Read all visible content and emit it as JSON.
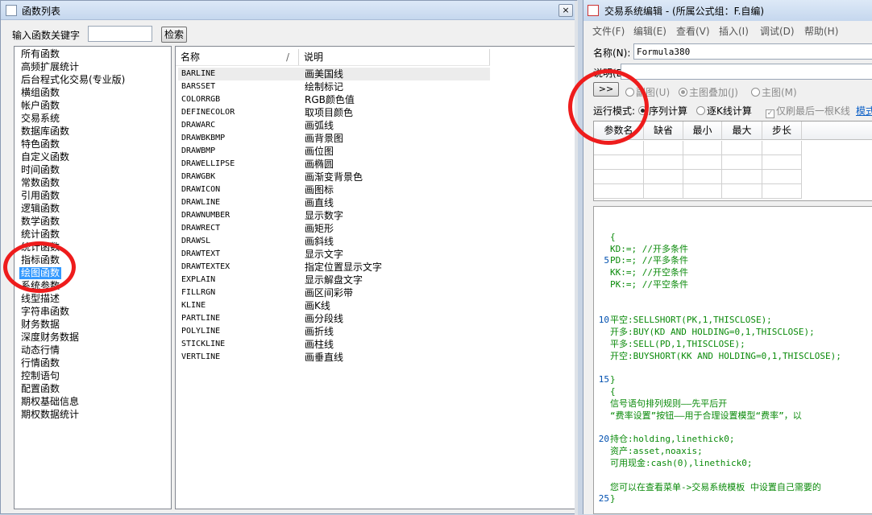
{
  "function_dialog": {
    "title": "函数列表",
    "close_label": "×",
    "keyword_label": "输入函数关键字",
    "keyword_value": "",
    "search_label": "检索",
    "categories": [
      "所有函数",
      "高频扩展统计",
      "后台程式化交易(专业版)",
      "横组函数",
      "帐户函数",
      "交易系统",
      "数据库函数",
      "特色函数",
      "自定义函数",
      "时间函数",
      "常数函数",
      "引用函数",
      "逻辑函数",
      "数学函数",
      "统计函数",
      "统计函数",
      "指标函数",
      "绘图函数",
      "系统参数",
      "线型描述",
      "字符串函数",
      "财务数据",
      "深度财务数据",
      "动态行情",
      "行情函数",
      "控制语句",
      "配置函数",
      "期权基础信息",
      "期权数据统计"
    ],
    "selected_category": "绘图函数",
    "columns": {
      "name": "名称",
      "sort_mark": "/",
      "desc": "说明"
    },
    "functions": [
      {
        "name": "BARLINE",
        "desc": "画美国线"
      },
      {
        "name": "BARSSET",
        "desc": "绘制标记"
      },
      {
        "name": "COLORRGB",
        "desc": "RGB颜色值"
      },
      {
        "name": "DEFINECOLOR",
        "desc": "取项目颜色"
      },
      {
        "name": "DRAWARC",
        "desc": "画弧线"
      },
      {
        "name": "DRAWBKBMP",
        "desc": "画背景图"
      },
      {
        "name": "DRAWBMP",
        "desc": "画位图"
      },
      {
        "name": "DRAWELLIPSE",
        "desc": "画椭圆"
      },
      {
        "name": "DRAWGBK",
        "desc": "画渐变背景色"
      },
      {
        "name": "DRAWICON",
        "desc": "画图标"
      },
      {
        "name": "DRAWLINE",
        "desc": "画直线"
      },
      {
        "name": "DRAWNUMBER",
        "desc": "显示数字"
      },
      {
        "name": "DRAWRECT",
        "desc": "画矩形"
      },
      {
        "name": "DRAWSL",
        "desc": "画斜线"
      },
      {
        "name": "DRAWTEXT",
        "desc": "显示文字"
      },
      {
        "name": "DRAWTEXTEX",
        "desc": "指定位置显示文字"
      },
      {
        "name": "EXPLAIN",
        "desc": "显示解盘文字"
      },
      {
        "name": "FILLRGN",
        "desc": "画区间彩带"
      },
      {
        "name": "KLINE",
        "desc": "画K线"
      },
      {
        "name": "PARTLINE",
        "desc": "画分段线"
      },
      {
        "name": "POLYLINE",
        "desc": "画折线"
      },
      {
        "name": "STICKLINE",
        "desc": "画柱线"
      },
      {
        "name": "VERTLINE",
        "desc": "画垂直线"
      }
    ]
  },
  "editor_window": {
    "title": "交易系统编辑 - (所属公式组：F.自编)",
    "menu": [
      "文件(F)",
      "编辑(E)",
      "查看(V)",
      "插入(I)",
      "调试(D)",
      "帮助(H)"
    ],
    "name_label": "名称(N):",
    "name_value": "Formula380",
    "desc_label": "说明(D):",
    "desc_value": "",
    "expand_label": ">>",
    "chart_options": [
      {
        "label": "副图(U)",
        "checked": false,
        "enabled": false
      },
      {
        "label": "主图叠加(J)",
        "checked": true,
        "enabled": false
      },
      {
        "label": "主图(M)",
        "checked": false,
        "enabled": false
      }
    ],
    "run_mode_label": "运行模式:",
    "run_modes": [
      {
        "label": "序列计算",
        "checked": true
      },
      {
        "label": "逐K线计算",
        "checked": false
      }
    ],
    "last_bar_label": "仅刷最后一根K线",
    "mode_link": "模式",
    "param_headers": [
      "参数名",
      "缺省",
      "最小",
      "最大",
      "步长"
    ],
    "code_lines": [
      {
        "n": "",
        "t": ""
      },
      {
        "n": "",
        "t": "{"
      },
      {
        "n": "",
        "t": "KD:=;          //开多条件"
      },
      {
        "n": "5",
        "t": "PD:=;          //平多条件"
      },
      {
        "n": "",
        "t": "KK:=;          //开空条件"
      },
      {
        "n": "",
        "t": "PK:=;          //平空条件"
      },
      {
        "n": "",
        "t": ""
      },
      {
        "n": "",
        "t": ""
      },
      {
        "n": "10",
        "t": "平空:SELLSHORT(PK,1,THISCLOSE);"
      },
      {
        "n": "",
        "t": "开多:BUY(KD AND HOLDING=0,1,THISCLOSE);"
      },
      {
        "n": "",
        "t": "平多:SELL(PD,1,THISCLOSE);"
      },
      {
        "n": "",
        "t": "开空:BUYSHORT(KK AND HOLDING=0,1,THISCLOSE);"
      },
      {
        "n": "",
        "t": ""
      },
      {
        "n": "15",
        "t": "}"
      },
      {
        "n": "",
        "t": "{"
      },
      {
        "n": "",
        "t": "信号语句排列规则——先平后开"
      },
      {
        "n": "",
        "t": "“费率设置”按钮——用于合理设置模型“费率”，以"
      },
      {
        "n": "",
        "t": ""
      },
      {
        "n": "20",
        "t": "持仓:holding,linethick0;"
      },
      {
        "n": "",
        "t": "资产:asset,noaxis;"
      },
      {
        "n": "",
        "t": "可用现金:cash(0),linethick0;"
      },
      {
        "n": "",
        "t": ""
      },
      {
        "n": "",
        "t": "您可以在查看菜单->交易系统模板 中设置自己需要的"
      },
      {
        "n": "25",
        "t": "}"
      }
    ]
  },
  "colors": {
    "annotation": "#ee1c1c",
    "selection": "#3399ff",
    "code_text": "#0a8a0a",
    "line_numbers": "#0050b0"
  }
}
